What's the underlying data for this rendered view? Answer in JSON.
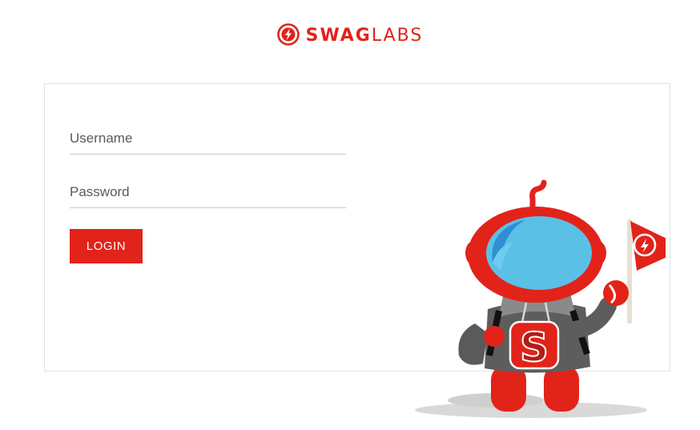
{
  "brand": {
    "name_bold": "SWAG",
    "name_light": "LABS",
    "color": "#e2231a",
    "icon": "lightning-bolt-icon"
  },
  "login_form": {
    "username_placeholder": "Username",
    "password_placeholder": "Password",
    "login_label": "LOGIN",
    "button_color": "#e2231a"
  },
  "illustration": {
    "subject": "robot-mascot-icon",
    "chest_letter": "S",
    "pennant_icon": "lightning-bolt-icon"
  }
}
